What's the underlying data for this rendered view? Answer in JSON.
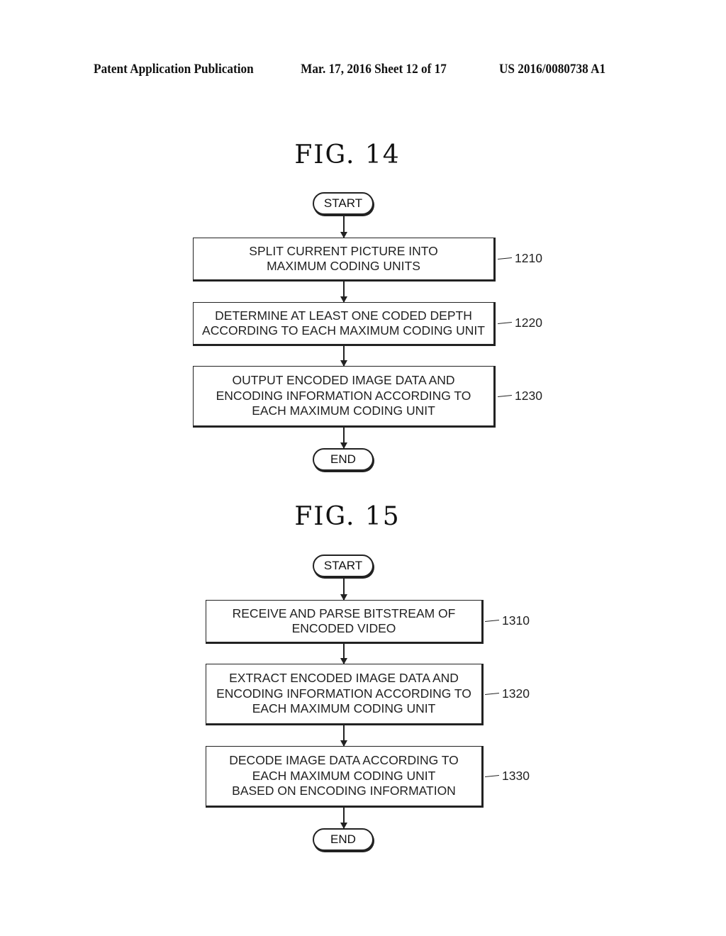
{
  "header": {
    "publication": "Patent Application Publication",
    "date_sheet": "Mar. 17, 2016  Sheet 12 of 17",
    "number": "US 2016/0080738 A1"
  },
  "figures": [
    {
      "title": "FIG.  14",
      "start": "START",
      "end": "END",
      "steps": [
        {
          "ref": "1210",
          "lines": [
            "SPLIT CURRENT PICTURE INTO",
            "MAXIMUM CODING UNITS"
          ]
        },
        {
          "ref": "1220",
          "lines": [
            "DETERMINE AT LEAST ONE CODED DEPTH",
            "ACCORDING TO EACH MAXIMUM CODING UNIT"
          ]
        },
        {
          "ref": "1230",
          "lines": [
            "OUTPUT ENCODED IMAGE DATA AND",
            "ENCODING INFORMATION ACCORDING TO",
            "EACH MAXIMUM CODING UNIT"
          ]
        }
      ]
    },
    {
      "title": "FIG.  15",
      "start": "START",
      "end": "END",
      "steps": [
        {
          "ref": "1310",
          "lines": [
            "RECEIVE AND PARSE BITSTREAM OF",
            "ENCODED VIDEO"
          ]
        },
        {
          "ref": "1320",
          "lines": [
            "EXTRACT ENCODED IMAGE DATA AND",
            "ENCODING INFORMATION ACCORDING TO",
            "EACH MAXIMUM CODING UNIT"
          ]
        },
        {
          "ref": "1330",
          "lines": [
            "DECODE IMAGE DATA ACCORDING TO",
            "EACH MAXIMUM CODING UNIT",
            "BASED ON ENCODING INFORMATION"
          ]
        }
      ]
    }
  ]
}
